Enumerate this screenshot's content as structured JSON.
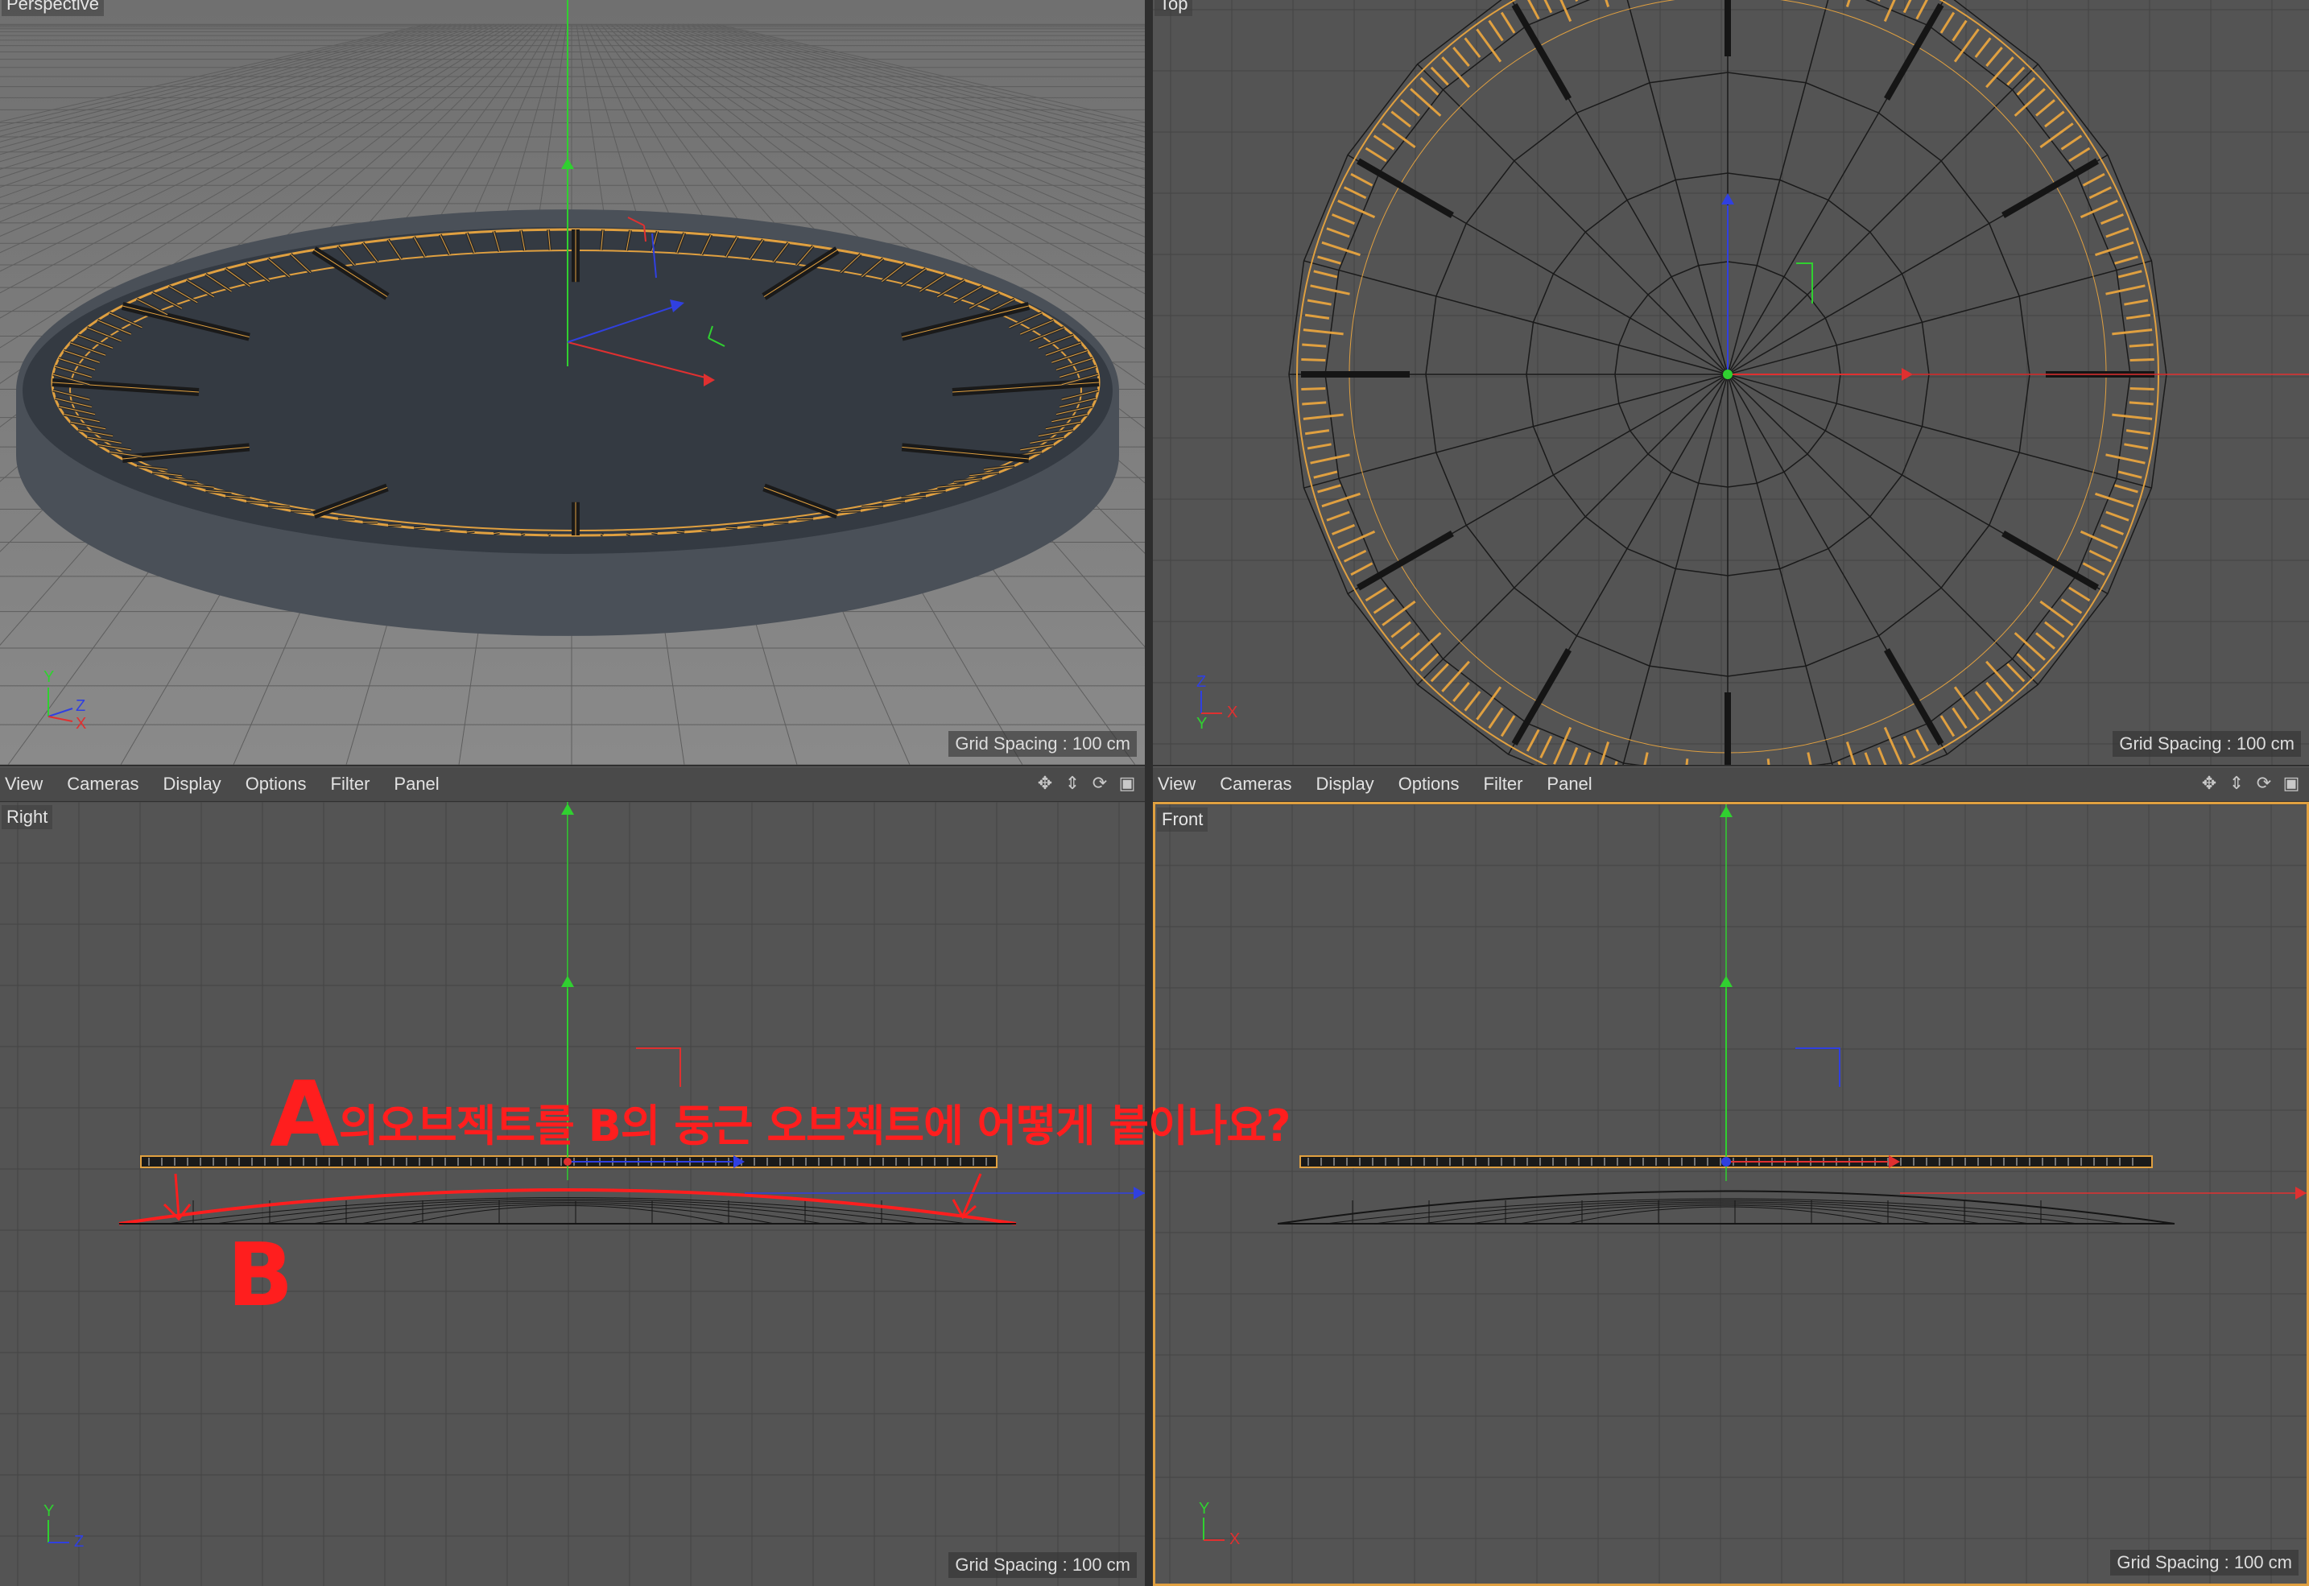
{
  "viewports": {
    "perspective": {
      "label": "Perspective",
      "grid_spacing": "Grid Spacing : 100 cm"
    },
    "top": {
      "label": "Top",
      "grid_spacing": "Grid Spacing : 100 cm"
    },
    "right": {
      "label": "Right",
      "grid_spacing": "Grid Spacing : 100 cm"
    },
    "front": {
      "label": "Front",
      "grid_spacing": "Grid Spacing : 100 cm"
    }
  },
  "menu": {
    "left": [
      "View",
      "Cameras",
      "Display",
      "Options",
      "Filter",
      "Panel"
    ],
    "right": [
      "View",
      "Cameras",
      "Display",
      "Options",
      "Filter",
      "Panel"
    ]
  },
  "nav_icons": [
    "move-icon",
    "zoom-icon",
    "rotate-icon",
    "maximize-icon"
  ],
  "axes": {
    "x": "X",
    "y": "Y",
    "z": "Z"
  },
  "annotation": {
    "question_big": "A",
    "question_rest": "의오브젝트를 B의 둥근 오브젝트에 어떻게 붙이나요?",
    "label_b": "B"
  },
  "colors": {
    "selection": "#e0a040",
    "axis_x": "#e03030",
    "axis_y": "#30d030",
    "axis_z": "#3040e0",
    "annotation": "#ff1e1e"
  }
}
